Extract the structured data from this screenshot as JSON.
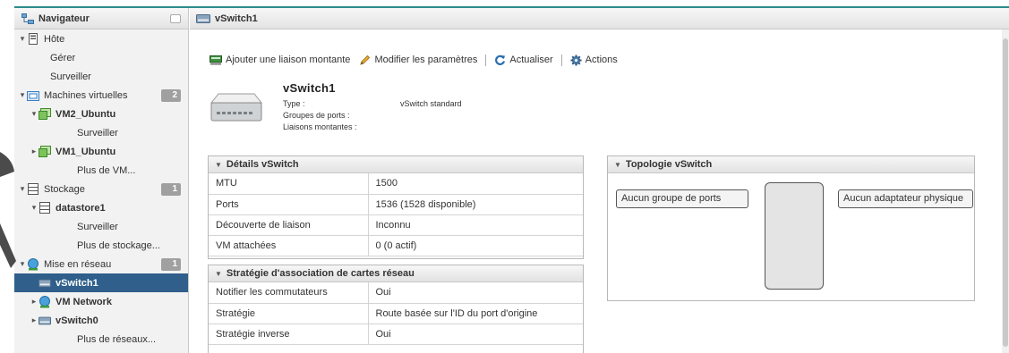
{
  "navigator": {
    "title": "Navigateur",
    "items": [
      {
        "label": "Hôte",
        "level": 0,
        "caret": "▾",
        "icon": "host-icon"
      },
      {
        "label": "Gérer",
        "level": 1
      },
      {
        "label": "Surveiller",
        "level": 1
      },
      {
        "label": "Machines virtuelles",
        "level": 0,
        "caret": "▾",
        "icon": "vm-folder-icon",
        "badge": "2"
      },
      {
        "label": "VM2_Ubuntu",
        "level": 1,
        "caret": "▾",
        "icon": "vm-icon"
      },
      {
        "label": "Surveiller",
        "level": 2
      },
      {
        "label": "VM1_Ubuntu",
        "level": 1,
        "caret": "▸",
        "icon": "vm-icon"
      },
      {
        "label": "Plus de VM...",
        "level": 2
      },
      {
        "label": "Stockage",
        "level": 0,
        "caret": "▾",
        "icon": "storage-icon",
        "badge": "1"
      },
      {
        "label": "datastore1",
        "level": 1,
        "caret": "▾",
        "icon": "datastore-icon"
      },
      {
        "label": "Surveiller",
        "level": 2
      },
      {
        "label": "Plus de stockage...",
        "level": 2
      },
      {
        "label": "Mise en réseau",
        "level": 0,
        "caret": "▾",
        "icon": "network-icon",
        "badge": "1"
      },
      {
        "label": "vSwitch1",
        "level": 1,
        "icon": "vswitch-icon",
        "selected": true
      },
      {
        "label": "VM Network",
        "level": 1,
        "caret": "▸",
        "icon": "portgroup-icon"
      },
      {
        "label": "vSwitch0",
        "level": 1,
        "caret": "▸",
        "icon": "vswitch-icon"
      },
      {
        "label": "Plus de réseaux...",
        "level": 2
      }
    ]
  },
  "main": {
    "title": "vSwitch1",
    "toolbar": {
      "add_uplink": "Ajouter une liaison montante",
      "edit_settings": "Modifier les paramètres",
      "refresh": "Actualiser",
      "actions": "Actions"
    },
    "summary": {
      "name": "vSwitch1",
      "type_label": "Type :",
      "type_value": "vSwitch standard",
      "portgroups_label": "Groupes de ports :",
      "uplinks_label": "Liaisons montantes :"
    },
    "details": {
      "title": "Détails vSwitch",
      "rows": [
        {
          "key": "MTU",
          "value": "1500"
        },
        {
          "key": "Ports",
          "value": "1536 (1528 disponible)"
        },
        {
          "key": "Découverte de liaison",
          "value": "Inconnu"
        },
        {
          "key": "VM attachées",
          "value": "0 (0 actif)"
        }
      ]
    },
    "teaming": {
      "title": "Stratégie d'association de cartes réseau",
      "rows": [
        {
          "key": "Notifier les commutateurs",
          "value": "Oui"
        },
        {
          "key": "Stratégie",
          "value": "Route basée sur l'ID du port d'origine"
        },
        {
          "key": "Stratégie inverse",
          "value": "Oui"
        }
      ]
    },
    "topology": {
      "title": "Topologie vSwitch",
      "portgroups_box": "Aucun groupe de ports",
      "adapters_box": "Aucun adaptateur physique"
    }
  },
  "colors": {
    "selected_bg": "#2f5f8a",
    "badge_bg": "#a0a0a0",
    "accent_frame": "#2e8a8a"
  }
}
